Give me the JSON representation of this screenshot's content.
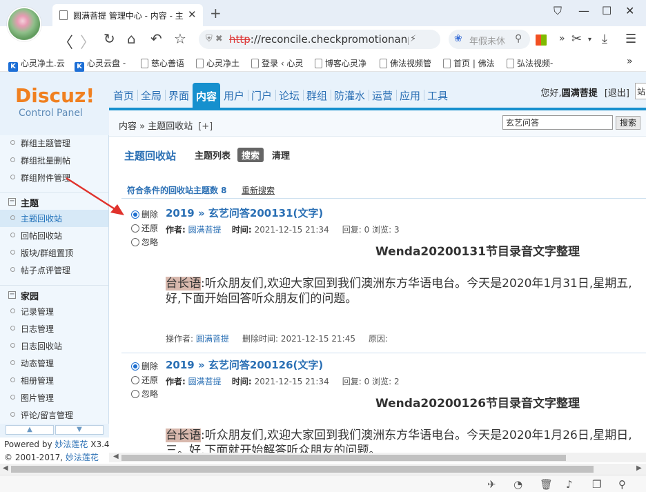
{
  "browser": {
    "tab_title": "圆满菩提 管理中心 - 内容 - 主",
    "url_proto": "http",
    "url_rest": "://reconcile.checkpromotionanph",
    "search_placeholder": "年假未休",
    "bookmarks": [
      "心灵净土.云",
      "心灵云盘 -",
      "慈心善语",
      "心灵净土",
      "登录 ‹ 心灵",
      "博客心灵净",
      "佛法视频管",
      "首页 | 佛法",
      "弘法视频-"
    ],
    "more": "»"
  },
  "header": {
    "logo": "Discuz!",
    "logo_sub": "Control Panel",
    "nav": [
      "首页",
      "全局",
      "界面",
      "内容",
      "用户",
      "门户",
      "论坛",
      "群组",
      "防灌水",
      "运营",
      "应用",
      "工具"
    ],
    "active_nav": "内容",
    "welcome_prefix": "您好,",
    "username": "圆满菩提",
    "logout": "[退出]",
    "cut": "站"
  },
  "breadcrumb": {
    "text": "内容 » 主题回收站",
    "add": "[+]",
    "search_value": "玄艺问答",
    "search_btn": "搜索"
  },
  "sidebar": {
    "items_top": [
      "群组主题管理",
      "群组批量删帖",
      "群组附件管理"
    ],
    "group_topic": "主题",
    "topic_items": [
      "主题回收站",
      "回帖回收站",
      "版块/群组置顶",
      "帖子点评管理"
    ],
    "group_home": "家园",
    "home_items": [
      "记录管理",
      "日志管理",
      "日志回收站",
      "动态管理",
      "相册管理",
      "图片管理",
      "评论/留言管理"
    ],
    "powered": "Powered by",
    "powered_link": "妙法莲花",
    "version": "X3.4",
    "copyright": "© 2001-2017,",
    "copyright_link": "妙法莲花"
  },
  "content": {
    "title": "主题回收站",
    "tabs": [
      "主题列表",
      "搜索",
      "清理"
    ],
    "result_text": "符合条件的回收站主题数 8",
    "research": "重新搜索",
    "options": [
      "删除",
      "还原",
      "忽略"
    ],
    "posts": [
      {
        "title": "2019 » 玄艺问答200131(文字)",
        "author_label": "作者:",
        "author": "圆满菩提",
        "time_label": "时间:",
        "time": "2021-12-15 21:34",
        "stats": "回复: 0 浏览: 3",
        "heading": "Wenda20200131节目录音文字整理",
        "speaker": "台长语",
        "body": ":听众朋友们,欢迎大家回到我们澳洲东方华语电台。今天是2020年1月31日,星期五,",
        "body2": "好,下面开始回答听众朋友们的问题。",
        "op_label": "操作者:",
        "operator": "圆满菩提",
        "del_time": "删除时间: 2021-12-15 21:45",
        "reason": "原因:"
      },
      {
        "title": "2019 » 玄艺问答200126(文字)",
        "author_label": "作者:",
        "author": "圆满菩提",
        "time_label": "时间:",
        "time": "2021-12-15 21:34",
        "stats": "回复: 0 浏览: 2",
        "heading": "Wenda20200126节目录音文字整理",
        "speaker": "台长语",
        "body": ":听众朋友们,欢迎大家回到我们澳洲东方华语电台。今天是2020年1月26日,星期日,",
        "body2": "三。好,下面就开始解答听众朋友的问题。"
      }
    ]
  },
  "colors": {
    "accent": "#1690ce",
    "link": "#2a6fb4",
    "logo": "#f08020"
  }
}
